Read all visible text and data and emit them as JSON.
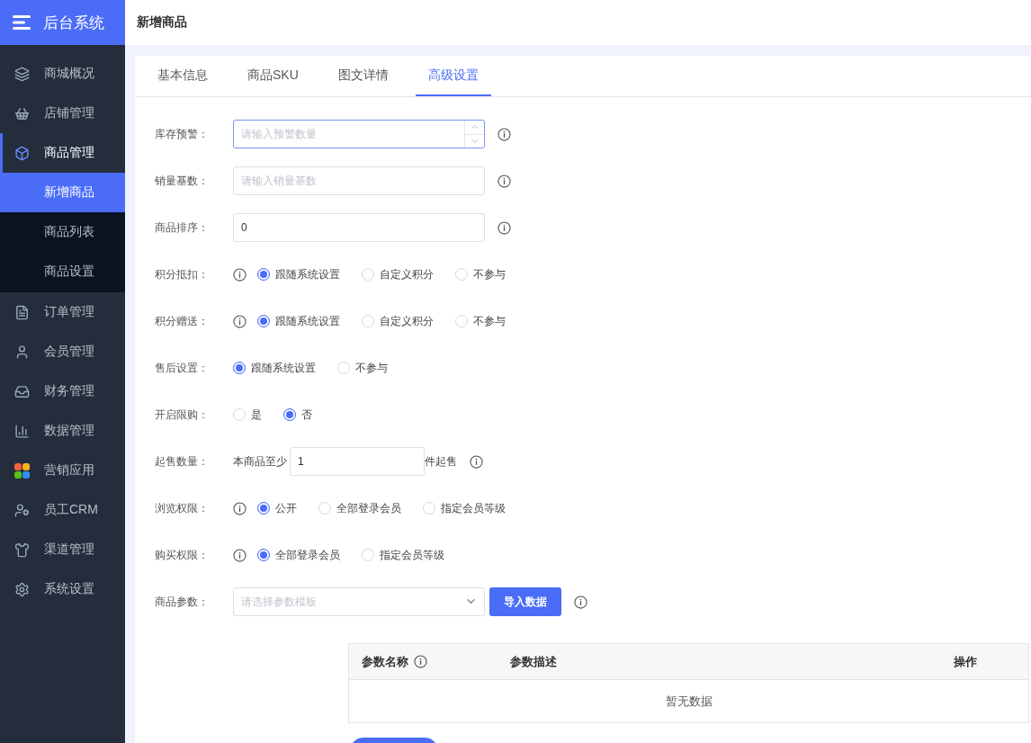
{
  "sidebar": {
    "title": "后台系统",
    "items": [
      {
        "label": "商城概况",
        "selected": false
      },
      {
        "label": "店铺管理",
        "selected": false
      },
      {
        "label": "商品管理",
        "selected": true,
        "expanded": true,
        "children": [
          {
            "label": "新增商品",
            "selected": true
          },
          {
            "label": "商品列表",
            "selected": false
          },
          {
            "label": "商品设置",
            "selected": false
          }
        ]
      },
      {
        "label": "订单管理",
        "selected": false
      },
      {
        "label": "会员管理",
        "selected": false
      },
      {
        "label": "财务管理",
        "selected": false
      },
      {
        "label": "数据管理",
        "selected": false
      },
      {
        "label": "营销应用",
        "selected": false
      },
      {
        "label": "员工CRM",
        "selected": false
      },
      {
        "label": "渠道管理",
        "selected": false
      },
      {
        "label": "系统设置",
        "selected": false
      }
    ]
  },
  "page_title": "新增商品",
  "tabs": [
    {
      "label": "基本信息",
      "selected": false
    },
    {
      "label": "商品SKU",
      "selected": false
    },
    {
      "label": "图文详情",
      "selected": false
    },
    {
      "label": "高级设置",
      "selected": true
    }
  ],
  "form": [
    {
      "kind": "number",
      "label": "库存预警：",
      "placeholder": "请输入预警数量",
      "focused": true,
      "info": true
    },
    {
      "kind": "input",
      "label": "销量基数：",
      "placeholder": "请输入销量基数",
      "focused": false,
      "info": true
    },
    {
      "kind": "input",
      "label": "商品排序：",
      "value": "0",
      "focused": false,
      "info": true
    },
    {
      "kind": "radio",
      "label": "积分抵扣：",
      "info": true,
      "options": [
        {
          "label": "跟随系统设置",
          "selected": true
        },
        {
          "label": "自定义积分",
          "selected": false
        },
        {
          "label": "不参与",
          "selected": false
        }
      ]
    },
    {
      "kind": "radio",
      "label": "积分赠送：",
      "info": true,
      "options": [
        {
          "label": "跟随系统设置",
          "selected": true
        },
        {
          "label": "自定义积分",
          "selected": false
        },
        {
          "label": "不参与",
          "selected": false
        }
      ]
    },
    {
      "kind": "radio",
      "label": "售后设置：",
      "info": false,
      "options": [
        {
          "label": "跟随系统设置",
          "selected": true
        },
        {
          "label": "不参与",
          "selected": false
        }
      ]
    },
    {
      "kind": "radio",
      "label": "开启限购：",
      "info": false,
      "options": [
        {
          "label": "是",
          "selected": false
        },
        {
          "label": "否",
          "selected": true
        }
      ]
    },
    {
      "kind": "quantity",
      "label": "起售数量：",
      "prefix": "本商品至少",
      "value": "1",
      "suffix": "件起售",
      "info": true
    },
    {
      "kind": "radio",
      "label": "浏览权限：",
      "info": true,
      "options": [
        {
          "label": "公开",
          "selected": true
        },
        {
          "label": "全部登录会员",
          "selected": false
        },
        {
          "label": "指定会员等级",
          "selected": false
        }
      ]
    },
    {
      "kind": "radio",
      "label": "购买权限：",
      "info": true,
      "options": [
        {
          "label": "全部登录会员",
          "selected": true
        },
        {
          "label": "指定会员等级",
          "selected": false
        }
      ]
    },
    {
      "kind": "select",
      "label": "商品参数：",
      "placeholder": "请选择参数模板",
      "button": "导入数据",
      "info": true
    }
  ],
  "params_table": {
    "columns": [
      {
        "label": "参数名称",
        "info": true
      },
      {
        "label": "参数描述",
        "info": false
      },
      {
        "label": "操作",
        "info": false
      }
    ],
    "empty_text": "暂无数据"
  }
}
